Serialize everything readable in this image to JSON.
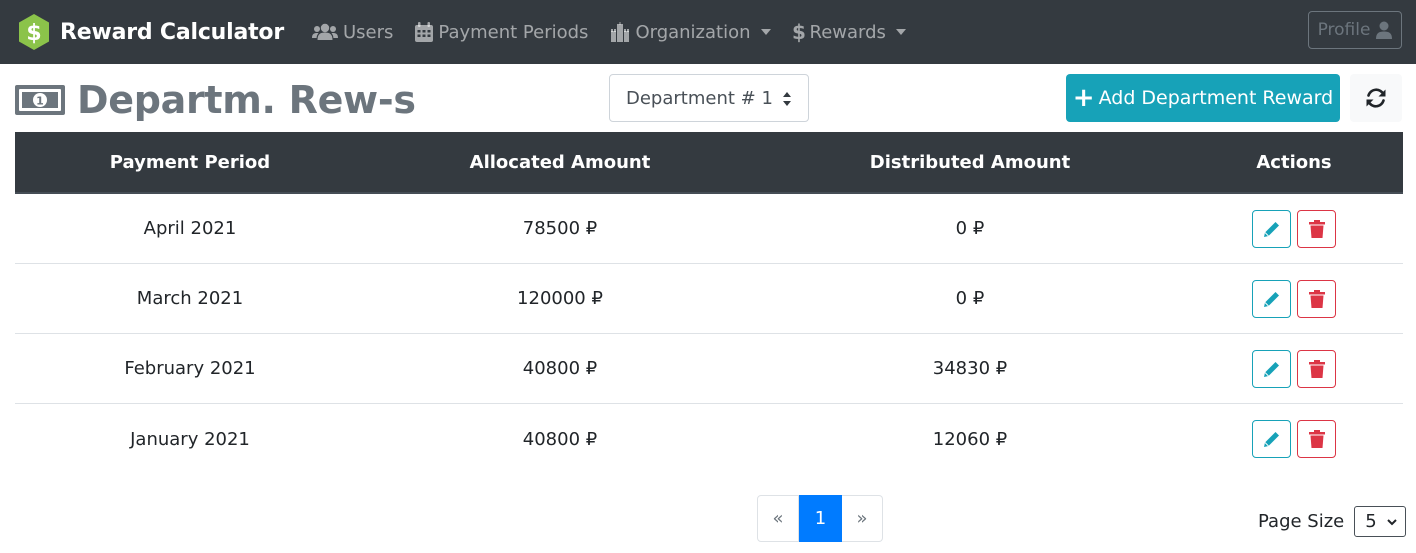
{
  "brand": {
    "title": "Reward Calculator",
    "logo_icon": "dollar-badge-icon",
    "logo_color": "#8bc34a"
  },
  "nav": {
    "items": [
      {
        "label": "Users",
        "icon": "users-icon"
      },
      {
        "label": "Payment Periods",
        "icon": "calendar-icon"
      },
      {
        "label": "Organization",
        "icon": "building-icon",
        "dropdown": true
      },
      {
        "label": "Rewards",
        "icon": "dollar-icon",
        "dropdown": true
      }
    ],
    "profile_label": "Profile"
  },
  "page": {
    "title": "Departm. Rew-s",
    "title_icon": "money-bill-icon",
    "department_selected": "Department # 1",
    "add_button_label": "Add Department Reward"
  },
  "table": {
    "headers": [
      "Payment Period",
      "Allocated Amount",
      "Distributed Amount",
      "Actions"
    ],
    "rows": [
      {
        "period": "April 2021",
        "allocated": "78500 ₽",
        "distributed": "0 ₽"
      },
      {
        "period": "March 2021",
        "allocated": "120000 ₽",
        "distributed": "0 ₽"
      },
      {
        "period": "February 2021",
        "allocated": "40800 ₽",
        "distributed": "34830 ₽"
      },
      {
        "period": "January 2021",
        "allocated": "40800 ₽",
        "distributed": "12060 ₽"
      }
    ]
  },
  "pagination": {
    "prev": "«",
    "current": "1",
    "next": "»"
  },
  "page_size": {
    "label": "Page Size",
    "value": "5"
  },
  "colors": {
    "navbar": "#343a40",
    "info": "#17a2b8",
    "danger": "#dc3545",
    "primary": "#007bff"
  }
}
